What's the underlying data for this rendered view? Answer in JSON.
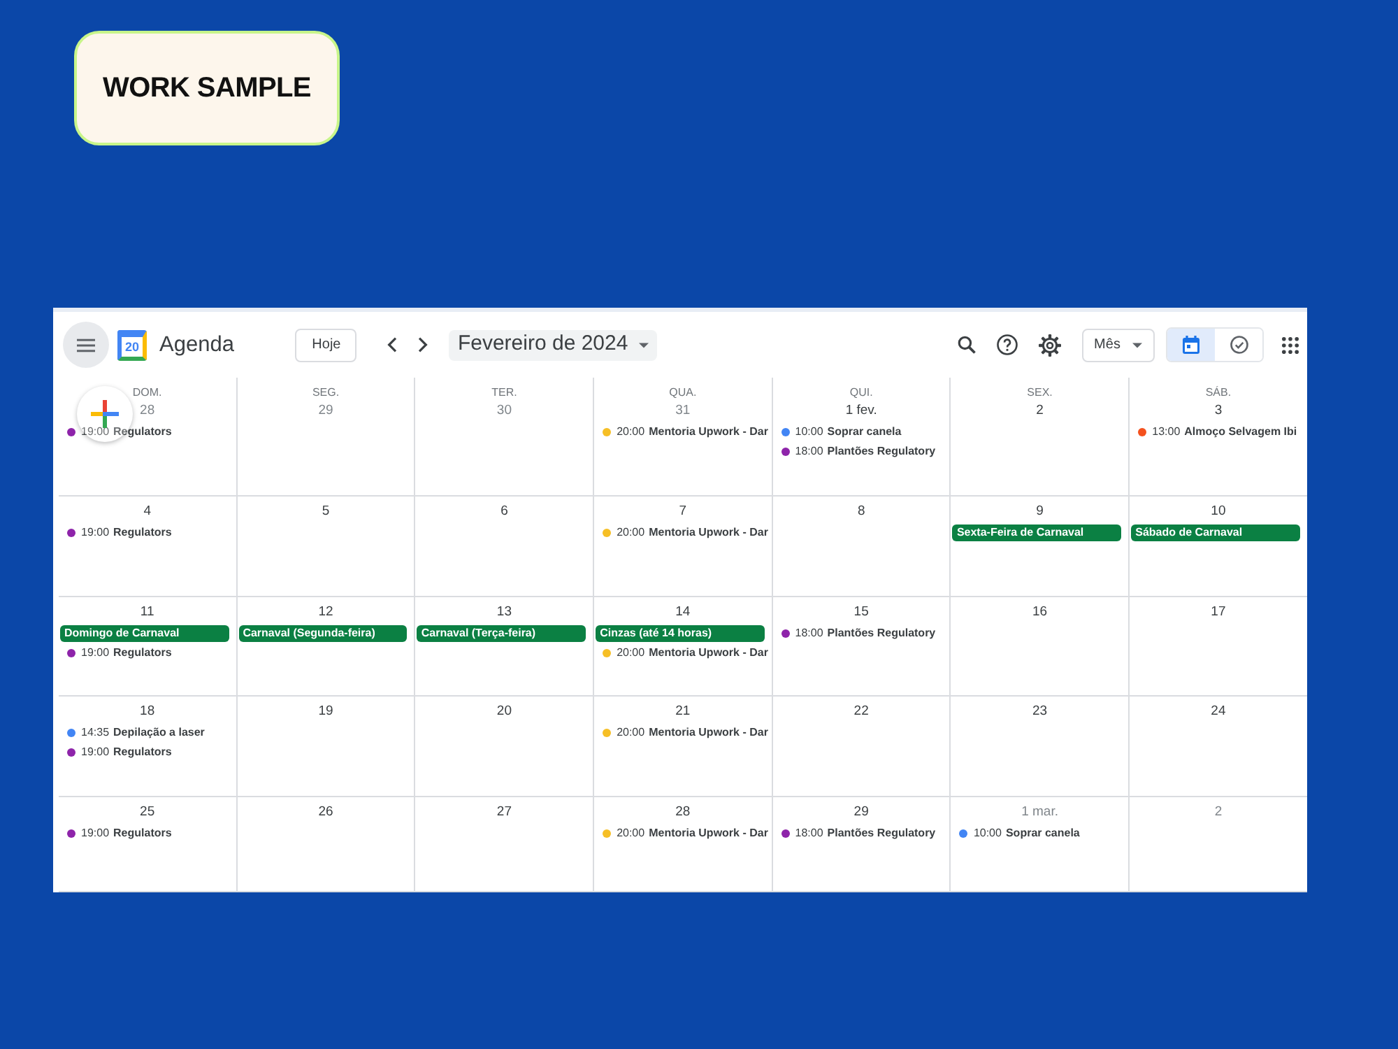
{
  "badge": {
    "text": "WORK SAMPLE"
  },
  "header": {
    "logo_text": "20",
    "app_name": "Agenda",
    "today_button": "Hoje",
    "period": "Fevereiro de 2024",
    "view_button": "Mês",
    "view_toggle": [
      {
        "kind": "calendar",
        "selected": true
      },
      {
        "kind": "tasks",
        "selected": false
      }
    ]
  },
  "weekdays": [
    "DOM.",
    "SEG.",
    "TER.",
    "QUA.",
    "QUI.",
    "SEX.",
    "SÁB."
  ],
  "weeks": [
    [
      {
        "label": "28",
        "other_month": true,
        "events": [
          {
            "kind": "timed",
            "time": "19:00",
            "title": "Regulators",
            "color": "#8e24aa"
          }
        ]
      },
      {
        "label": "29",
        "other_month": true
      },
      {
        "label": "30",
        "other_month": true
      },
      {
        "label": "31",
        "other_month": true,
        "events": [
          {
            "kind": "timed",
            "time": "20:00",
            "title": "Mentoria Upwork - Dar",
            "color": "#f6bf26"
          }
        ]
      },
      {
        "label": "1 fev.",
        "other_month": false,
        "events": [
          {
            "kind": "timed",
            "time": "10:00",
            "title": "Soprar canela",
            "color": "#4285f4"
          },
          {
            "kind": "timed",
            "time": "18:00",
            "title": "Plantões Regulatory",
            "color": "#8e24aa"
          }
        ]
      },
      {
        "label": "2",
        "other_month": false
      },
      {
        "label": "3",
        "other_month": false,
        "events": [
          {
            "kind": "timed",
            "time": "13:00",
            "title": "Almoço Selvagem Ibi",
            "color": "#f4511e"
          }
        ]
      }
    ],
    [
      {
        "label": "4",
        "other_month": false,
        "events": [
          {
            "kind": "timed",
            "time": "19:00",
            "title": "Regulators",
            "color": "#8e24aa"
          }
        ]
      },
      {
        "label": "5",
        "other_month": false
      },
      {
        "label": "6",
        "other_month": false
      },
      {
        "label": "7",
        "other_month": false,
        "events": [
          {
            "kind": "timed",
            "time": "20:00",
            "title": "Mentoria Upwork - Dar",
            "color": "#f6bf26"
          }
        ]
      },
      {
        "label": "8",
        "other_month": false
      },
      {
        "label": "9",
        "other_month": false,
        "events": [
          {
            "kind": "all_day",
            "title": "Sexta-Feira de Carnaval",
            "color": "#0b8043"
          }
        ]
      },
      {
        "label": "10",
        "other_month": false,
        "events": [
          {
            "kind": "all_day",
            "title": "Sábado de Carnaval",
            "color": "#0b8043"
          }
        ]
      }
    ],
    [
      {
        "label": "11",
        "other_month": false,
        "events": [
          {
            "kind": "all_day",
            "title": "Domingo de Carnaval",
            "color": "#0b8043"
          },
          {
            "kind": "timed",
            "time": "19:00",
            "title": "Regulators",
            "color": "#8e24aa"
          }
        ]
      },
      {
        "label": "12",
        "other_month": false,
        "events": [
          {
            "kind": "all_day",
            "title": "Carnaval (Segunda-feira)",
            "color": "#0b8043"
          }
        ]
      },
      {
        "label": "13",
        "other_month": false,
        "events": [
          {
            "kind": "all_day",
            "title": "Carnaval (Terça-feira)",
            "color": "#0b8043"
          }
        ]
      },
      {
        "label": "14",
        "other_month": false,
        "events": [
          {
            "kind": "all_day",
            "title": "Cinzas (até 14 horas)",
            "color": "#0b8043"
          },
          {
            "kind": "timed",
            "time": "20:00",
            "title": "Mentoria Upwork - Dar",
            "color": "#f6bf26"
          }
        ]
      },
      {
        "label": "15",
        "other_month": false,
        "events": [
          {
            "kind": "timed",
            "time": "18:00",
            "title": "Plantões Regulatory",
            "color": "#8e24aa"
          }
        ]
      },
      {
        "label": "16",
        "other_month": false
      },
      {
        "label": "17",
        "other_month": false
      }
    ],
    [
      {
        "label": "18",
        "other_month": false,
        "events": [
          {
            "kind": "timed",
            "time": "14:35",
            "title": "Depilação a laser",
            "color": "#4285f4"
          },
          {
            "kind": "timed",
            "time": "19:00",
            "title": "Regulators",
            "color": "#8e24aa"
          }
        ]
      },
      {
        "label": "19",
        "other_month": false
      },
      {
        "label": "20",
        "other_month": false
      },
      {
        "label": "21",
        "other_month": false,
        "events": [
          {
            "kind": "timed",
            "time": "20:00",
            "title": "Mentoria Upwork - Dar",
            "color": "#f6bf26"
          }
        ]
      },
      {
        "label": "22",
        "other_month": false
      },
      {
        "label": "23",
        "other_month": false
      },
      {
        "label": "24",
        "other_month": false
      }
    ],
    [
      {
        "label": "25",
        "other_month": false,
        "events": [
          {
            "kind": "timed",
            "time": "19:00",
            "title": "Regulators",
            "color": "#8e24aa"
          }
        ]
      },
      {
        "label": "26",
        "other_month": false
      },
      {
        "label": "27",
        "other_month": false
      },
      {
        "label": "28",
        "other_month": false,
        "events": [
          {
            "kind": "timed",
            "time": "20:00",
            "title": "Mentoria Upwork - Dar",
            "color": "#f6bf26"
          }
        ]
      },
      {
        "label": "29",
        "other_month": false,
        "events": [
          {
            "kind": "timed",
            "time": "18:00",
            "title": "Plantões Regulatory",
            "color": "#8e24aa"
          }
        ]
      },
      {
        "label": "1 mar.",
        "other_month": true,
        "events": [
          {
            "kind": "timed",
            "time": "10:00",
            "title": "Soprar canela",
            "color": "#4285f4"
          }
        ]
      },
      {
        "label": "2",
        "other_month": true
      }
    ]
  ]
}
